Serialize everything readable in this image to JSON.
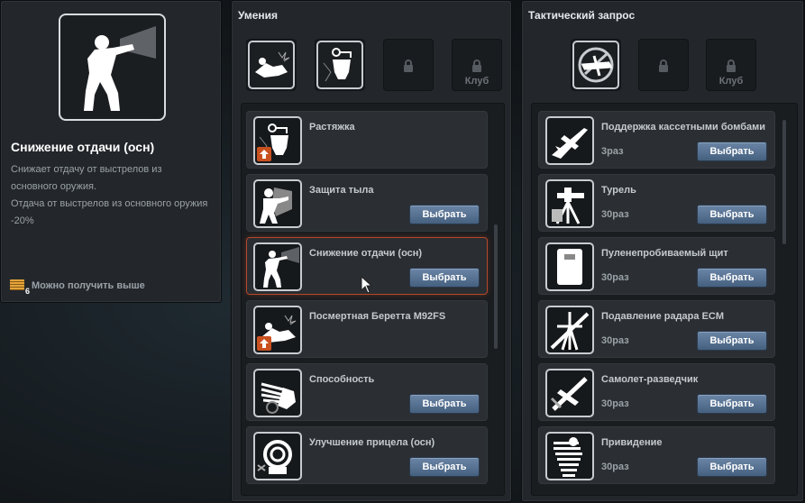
{
  "info": {
    "title": "Снижение отдачи (осн)",
    "description_lines": [
      "Снижает отдачу от выстрелов из",
      "основного оружия.",
      "Отдача от выстрелов из основного оружия",
      "-20%"
    ],
    "unlock_text": "Можно получить выше",
    "rank_number": "6",
    "icon": "recoil-soldier-icon"
  },
  "skills": {
    "title": "Умения",
    "slots": [
      {
        "state": "filled",
        "icon": "dead-soldier-icon"
      },
      {
        "state": "filled",
        "icon": "grenade-tripwire-icon"
      },
      {
        "state": "locked",
        "label": ""
      },
      {
        "state": "locked",
        "label": "Клуб"
      }
    ],
    "items": [
      {
        "name": "Растяжка",
        "icon": "grenade-tripwire-icon",
        "upgrade": true,
        "button": ""
      },
      {
        "name": "Защита тыла",
        "icon": "back-guard-icon",
        "upgrade": false,
        "button": "Выбрать"
      },
      {
        "name": "Снижение отдачи (осн)",
        "icon": "recoil-soldier-icon",
        "upgrade": false,
        "button": "Выбрать",
        "selected": true
      },
      {
        "name": "Посмертная Беретта M92FS",
        "icon": "dead-soldier-icon",
        "upgrade": true,
        "button": ""
      },
      {
        "name": "Способность",
        "icon": "hand-ability-icon",
        "upgrade": false,
        "button": "Выбрать"
      },
      {
        "name": "Улучшение прицела (осн)",
        "icon": "scope-upgrade-icon",
        "upgrade": false,
        "button": "Выбрать"
      }
    ]
  },
  "tactical": {
    "title": "Тактический запрос",
    "slots": [
      {
        "state": "filled",
        "icon": "no-airplane-icon"
      },
      {
        "state": "locked",
        "label": ""
      },
      {
        "state": "locked",
        "label": "Клуб"
      }
    ],
    "items": [
      {
        "name": "Поддержка кассетными бомбами",
        "uses": "3раз",
        "icon": "jet-icon",
        "button": "Выбрать"
      },
      {
        "name": "Турель",
        "uses": "30раз",
        "icon": "turret-icon",
        "button": "Выбрать"
      },
      {
        "name": "Пуленепробиваемый щит",
        "uses": "30раз",
        "icon": "shield-icon",
        "button": "Выбрать"
      },
      {
        "name": "Подавление радара ECM",
        "uses": "30раз",
        "icon": "radar-jam-icon",
        "button": "Выбрать"
      },
      {
        "name": "Самолет-разведчик",
        "uses": "30раз",
        "icon": "scout-plane-icon",
        "button": "Выбрать"
      },
      {
        "name": "Привидение",
        "uses": "30раз",
        "icon": "ghost-icon",
        "button": "Выбрать"
      }
    ]
  }
}
